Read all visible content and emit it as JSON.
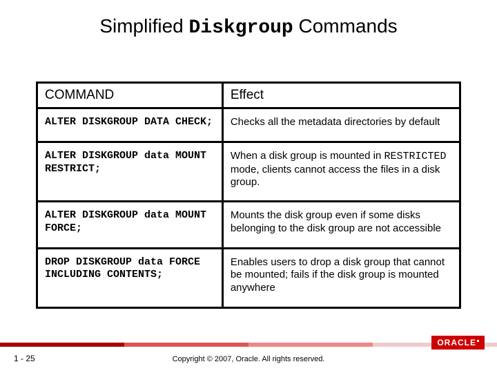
{
  "title": {
    "pre": "Simplified ",
    "mono": "Diskgroup",
    "post": " Commands"
  },
  "table": {
    "headers": {
      "col1": "COMMAND",
      "col2": "Effect"
    },
    "rows": [
      {
        "cmd": "ALTER DISKGROUP DATA CHECK;",
        "eff_pre": "Checks all the metadata directories by default",
        "eff_mono": "",
        "eff_post": ""
      },
      {
        "cmd": "ALTER DISKGROUP data MOUNT RESTRICT;",
        "eff_pre": "When a disk group is mounted in ",
        "eff_mono": "RESTRICTED",
        "eff_post": " mode, clients cannot access the files in a disk group."
      },
      {
        "cmd": "ALTER DISKGROUP data MOUNT FORCE;",
        "eff_pre": "Mounts the disk group even if some disks belonging to the disk group are not accessible",
        "eff_mono": "",
        "eff_post": ""
      },
      {
        "cmd": "DROP DISKGROUP data FORCE INCLUDING CONTENTS;",
        "eff_pre": "Enables users to drop a disk group that cannot be mounted; fails if the disk group is mounted anywhere",
        "eff_mono": "",
        "eff_post": ""
      }
    ]
  },
  "footer": {
    "slide_num": "1 - 25",
    "copyright": "Copyright © 2007, Oracle. All rights reserved.",
    "logo": "ORACLE"
  }
}
